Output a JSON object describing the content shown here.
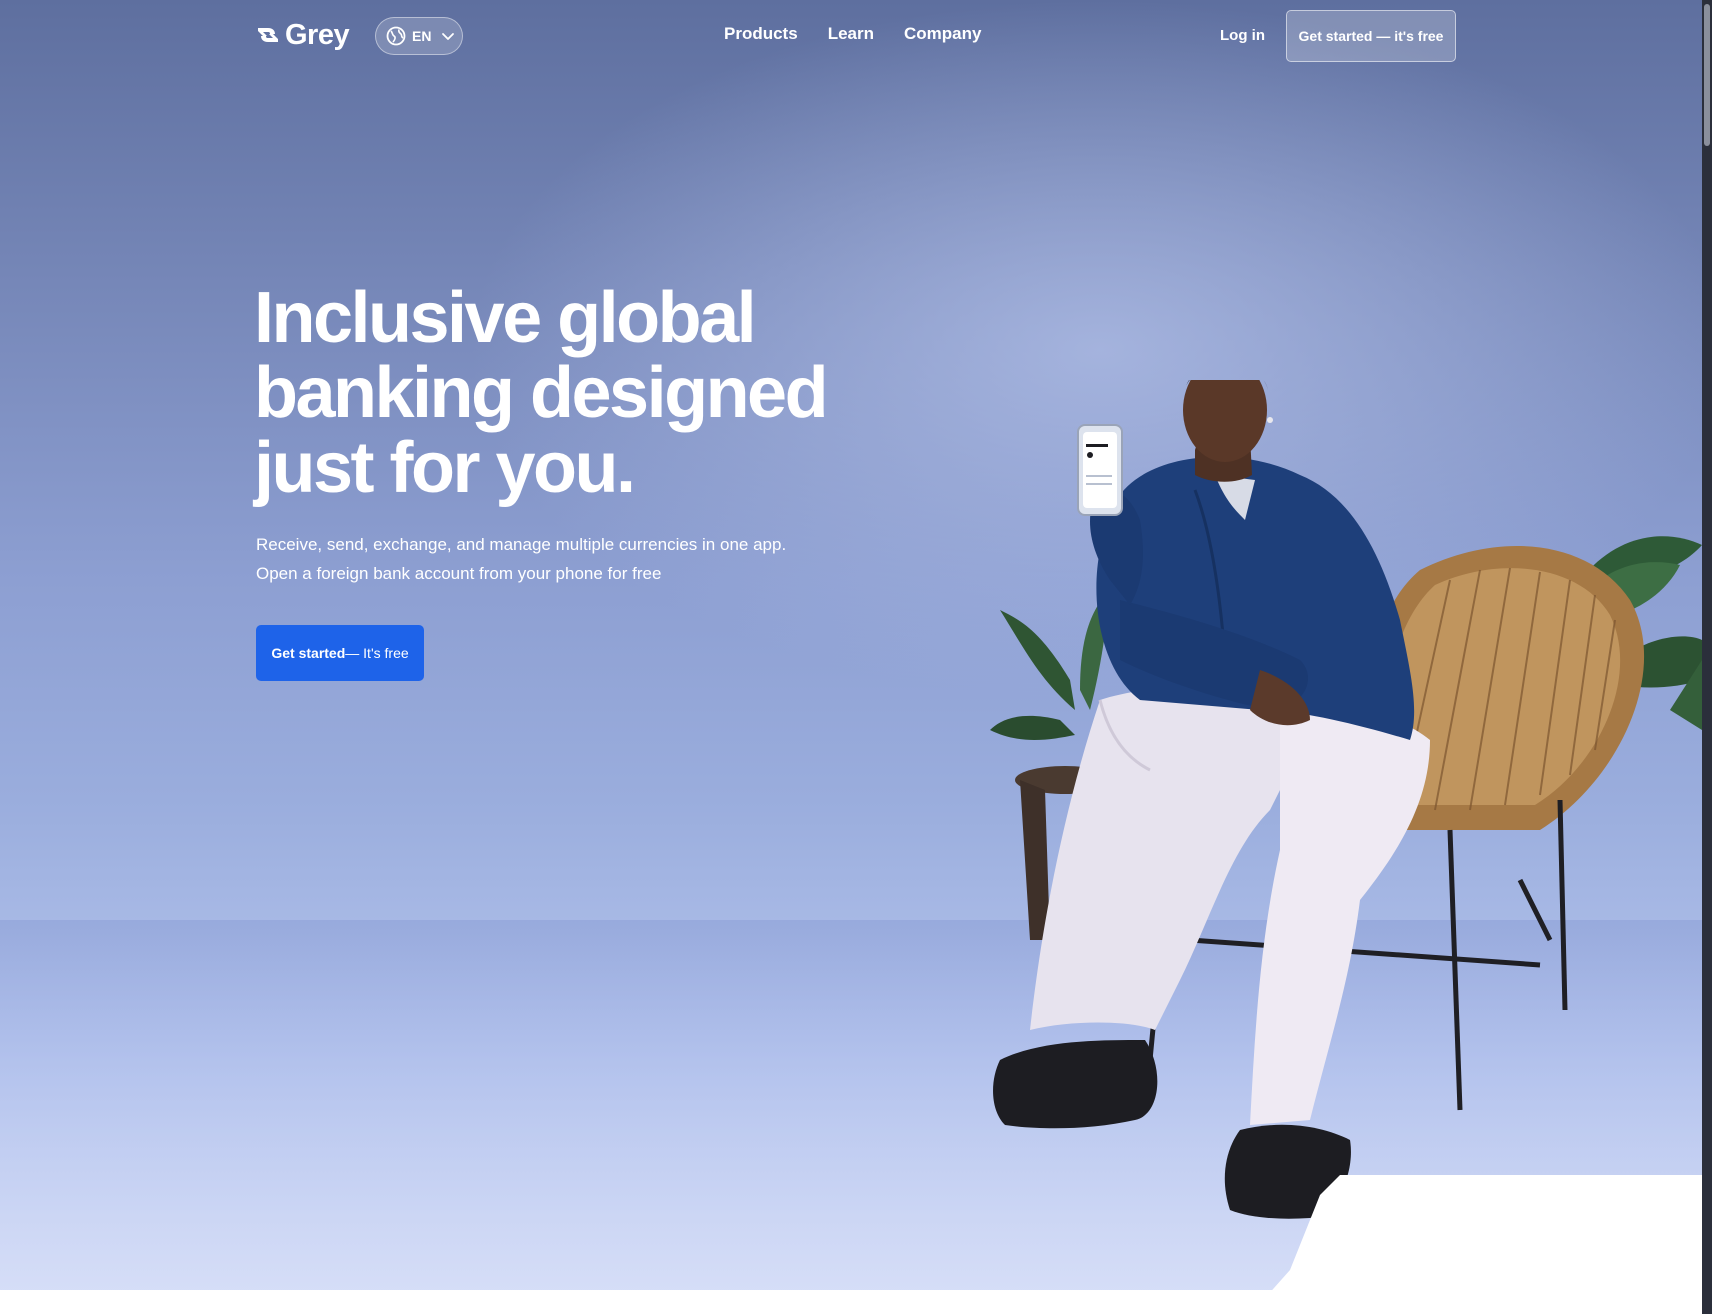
{
  "nav": {
    "brand": "Grey",
    "language": "EN",
    "links": [
      "Products",
      "Learn",
      "Company"
    ],
    "login": "Log in",
    "cta": "Get started — it's free"
  },
  "hero": {
    "headline_lines": [
      "Inclusive global",
      "banking designed",
      "just for you."
    ],
    "subtitle_lines": [
      "Receive, send, exchange, and manage multiple currencies in one app.",
      "Open a foreign bank account from your phone for free"
    ],
    "cta_bold": "Get started",
    "cta_rest": "— It's free"
  },
  "colors": {
    "cta_blue": "#1e63e9",
    "hero_top": "#5e6f9f",
    "hero_bottom": "#d3dcf6"
  },
  "icons": [
    "grey-logo-icon",
    "globe-icon",
    "chevron-down-icon"
  ]
}
